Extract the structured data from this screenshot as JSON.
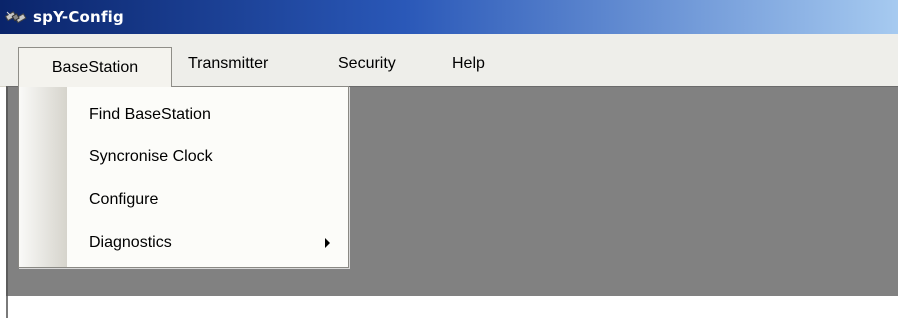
{
  "window": {
    "title": "spY-Config",
    "icon": "satellite-icon"
  },
  "menubar": {
    "items": [
      {
        "label": "BaseStation",
        "active": true
      },
      {
        "label": "Transmitter",
        "active": false
      },
      {
        "label": "Security",
        "active": false
      },
      {
        "label": "Help",
        "active": false
      }
    ]
  },
  "dropdown": {
    "parent": "BaseStation",
    "items": [
      {
        "label": "Find BaseStation",
        "has_submenu": false
      },
      {
        "label": "Syncronise Clock",
        "has_submenu": false
      },
      {
        "label": "Configure",
        "has_submenu": false
      },
      {
        "label": "Diagnostics",
        "has_submenu": true,
        "submenu_icon": "chevron-right-icon"
      }
    ]
  },
  "colors": {
    "titlebar_start": "#0a246a",
    "titlebar_end": "#a6caf0",
    "menubar_bg": "#eeeeea",
    "client_bg": "#818181",
    "dropdown_bg": "#fcfcf9"
  }
}
